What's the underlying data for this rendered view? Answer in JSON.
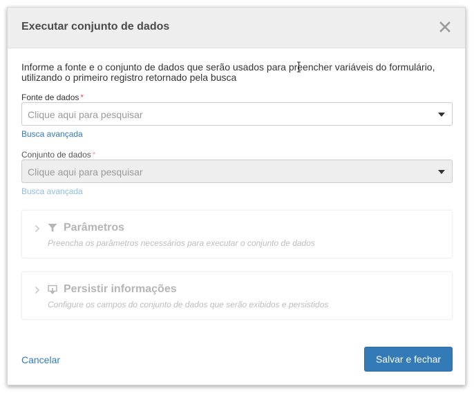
{
  "modal": {
    "title": "Executar conjunto de dados",
    "description": "Informe a fonte e o conjunto de dados que serão usados para preencher variáveis do formulário, utilizando o primeiro registro retornado pela busca"
  },
  "fields": {
    "data_source": {
      "label": "Fonte de dados",
      "required_mark": "*",
      "placeholder": "Clique aqui para pesquisar",
      "advanced_link": "Busca avançada"
    },
    "dataset": {
      "label": "Conjunto de dados",
      "required_mark": "*",
      "placeholder": "Clique aqui para pesquisar",
      "advanced_link": "Busca avançada"
    }
  },
  "panels": {
    "parameters": {
      "title": "Parâmetros",
      "subtitle": "Preencha os parâmetros necessários para executar o conjunto de dados",
      "icon": "filter-icon"
    },
    "persist": {
      "title": "Persistir informações",
      "subtitle": "Configure os campos do conjunto de dados que serão exibidos e persistidos",
      "icon": "monitor-download-icon"
    }
  },
  "footer": {
    "cancel_label": "Cancelar",
    "save_label": "Salvar e fechar"
  },
  "colors": {
    "primary": "#337ab7",
    "required": "#d9534f",
    "header_bg": "#eeeeee",
    "disabled_text": "#b5b5b5"
  }
}
